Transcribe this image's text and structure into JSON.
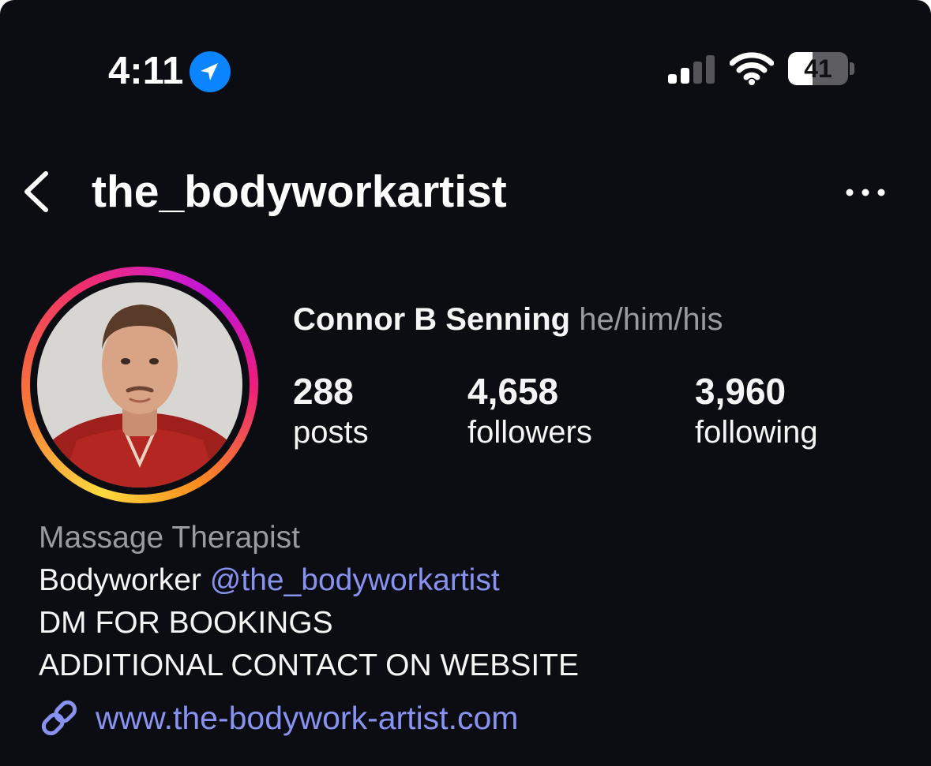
{
  "status_bar": {
    "time": "4:11",
    "battery_level": "41",
    "battery_fraction": 0.41,
    "signal_bars_active": 2,
    "icons": [
      "location-arrow-icon",
      "cellular-signal-icon",
      "wifi-icon",
      "battery-icon"
    ]
  },
  "nav": {
    "username": "the_bodyworkartist",
    "back_icon": "chevron-left-icon",
    "more_icon": "more-horizontal-icon"
  },
  "profile": {
    "name": "Connor B Senning",
    "pronouns": "he/him/his",
    "stats": [
      {
        "value": "288",
        "label": "posts"
      },
      {
        "value": "4,658",
        "label": "followers"
      },
      {
        "value": "3,960",
        "label": "following"
      }
    ]
  },
  "bio": {
    "category": "Massage Therapist",
    "line1_text": "Bodyworker",
    "line1_mention": "@the_bodyworkartist",
    "line2": "DM FOR BOOKINGS",
    "line3": "ADDITIONAL CONTACT ON WEBSITE",
    "link": "www.the-bodywork-artist.com",
    "link_icon": "link-icon"
  },
  "colors": {
    "background": "#0c0d12",
    "link": "#8892f0",
    "muted": "#9a9aa2",
    "location_badge": "#0a84ff"
  }
}
